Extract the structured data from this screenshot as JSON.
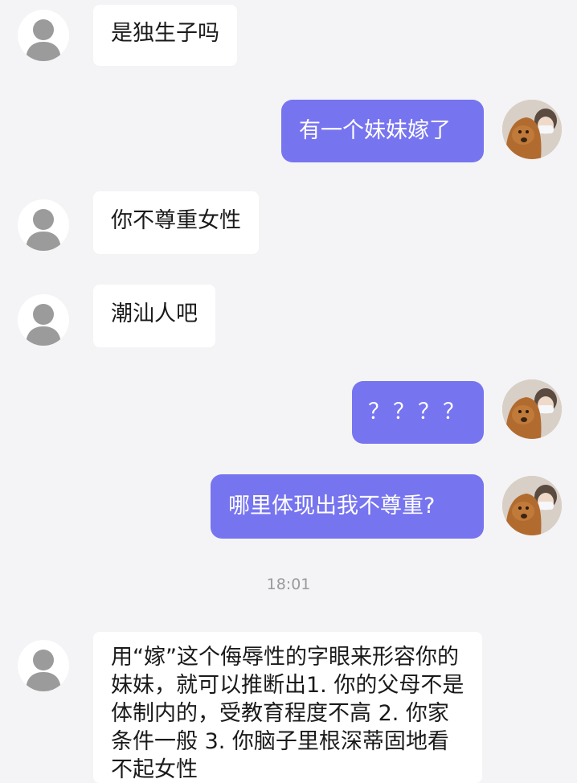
{
  "messages": [
    {
      "id": "m1",
      "side": "left",
      "text": "是独生子吗"
    },
    {
      "id": "m2",
      "side": "right",
      "text": "有一个妹妹嫁了"
    },
    {
      "id": "m3",
      "side": "left",
      "text": "你不尊重女性"
    },
    {
      "id": "m4",
      "side": "left",
      "text": "潮汕人吧"
    },
    {
      "id": "m5",
      "side": "right",
      "text": "？？？？"
    },
    {
      "id": "m6",
      "side": "right",
      "text": "哪里体现出我不尊重?"
    },
    {
      "id": "m7",
      "side": "left",
      "text": "用“嫁”这个侮辱性的字眼来形容你的妹妹，就可以推断出1. 你的父母不是体制内的，受教育程度不高 2. 你家条件一般 3. 你脑子里根深蒂固地看不起女性"
    }
  ],
  "timestamp": "18:01",
  "colors": {
    "background": "#f4f4f6",
    "incoming_bubble": "#ffffff",
    "outgoing_bubble": "#7774f0",
    "default_avatar": "#9b9b9b"
  },
  "icons": {
    "contact_avatar": "default-person-icon",
    "own_avatar": "photo-avatar-dog-person"
  }
}
